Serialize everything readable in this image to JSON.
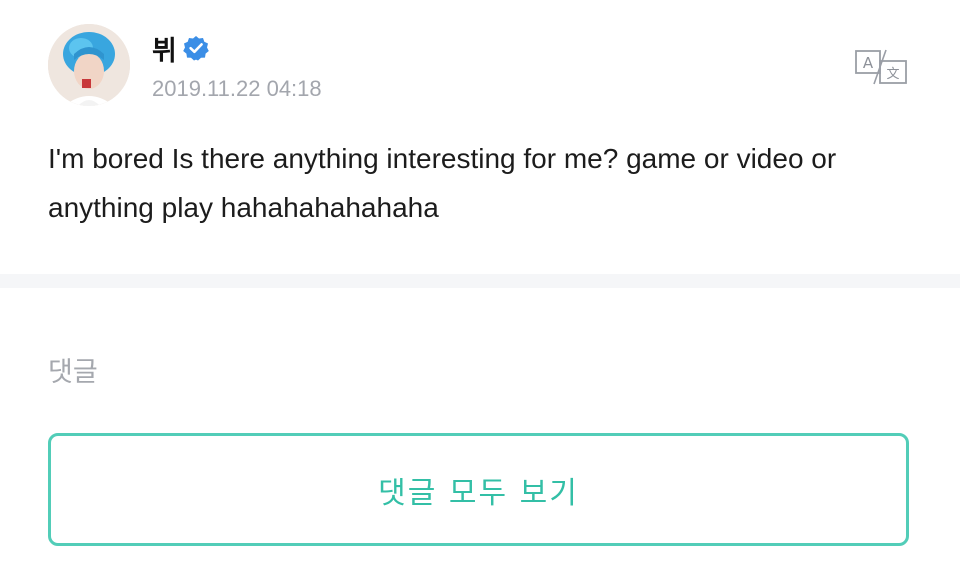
{
  "post": {
    "author_name": "뷔",
    "verified_icon": "verified-check-icon",
    "timestamp": "2019.11.22 04:18",
    "translate_icon": "translate-icon",
    "body": "I'm bored Is there anything interesting for me? game or video or anything play hahahahahahaha"
  },
  "comments": {
    "section_label": "댓글",
    "view_all_label": "댓글 모두 보기"
  },
  "colors": {
    "accent": "#33bfa6",
    "verified": "#3b8ee6",
    "divider": "#f5f6f8"
  }
}
